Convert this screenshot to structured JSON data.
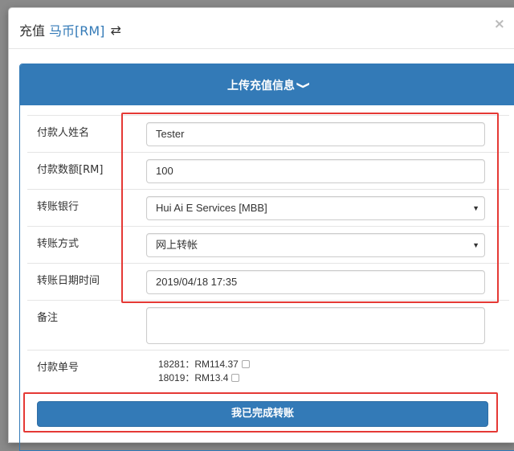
{
  "header": {
    "title_prefix": "充值",
    "currency_link": "马币[RM]",
    "swap_icon": "⇄",
    "close_icon": "×"
  },
  "panel": {
    "heading": "上传充值信息",
    "chevron": "❯"
  },
  "form": {
    "payer_name": {
      "label": "付款人姓名",
      "value": "Tester"
    },
    "amount": {
      "label": "付款数额[RM]",
      "value": "100"
    },
    "bank": {
      "label": "转账银行",
      "value": "Hui Ai E Services [MBB]"
    },
    "method": {
      "label": "转账方式",
      "value": "网上转帐"
    },
    "datetime": {
      "label": "转账日期时间",
      "value": "2019/04/18 17:35"
    },
    "remark": {
      "label": "备注",
      "value": ""
    },
    "order_no": {
      "label": "付款单号",
      "items": [
        {
          "text": "18281：RM114.37",
          "checked": false
        },
        {
          "text": "18019：RM13.4",
          "checked": false
        }
      ]
    }
  },
  "submit_label": "我已完成转账",
  "colors": {
    "primary": "#337ab7",
    "highlight": "#e53935"
  }
}
